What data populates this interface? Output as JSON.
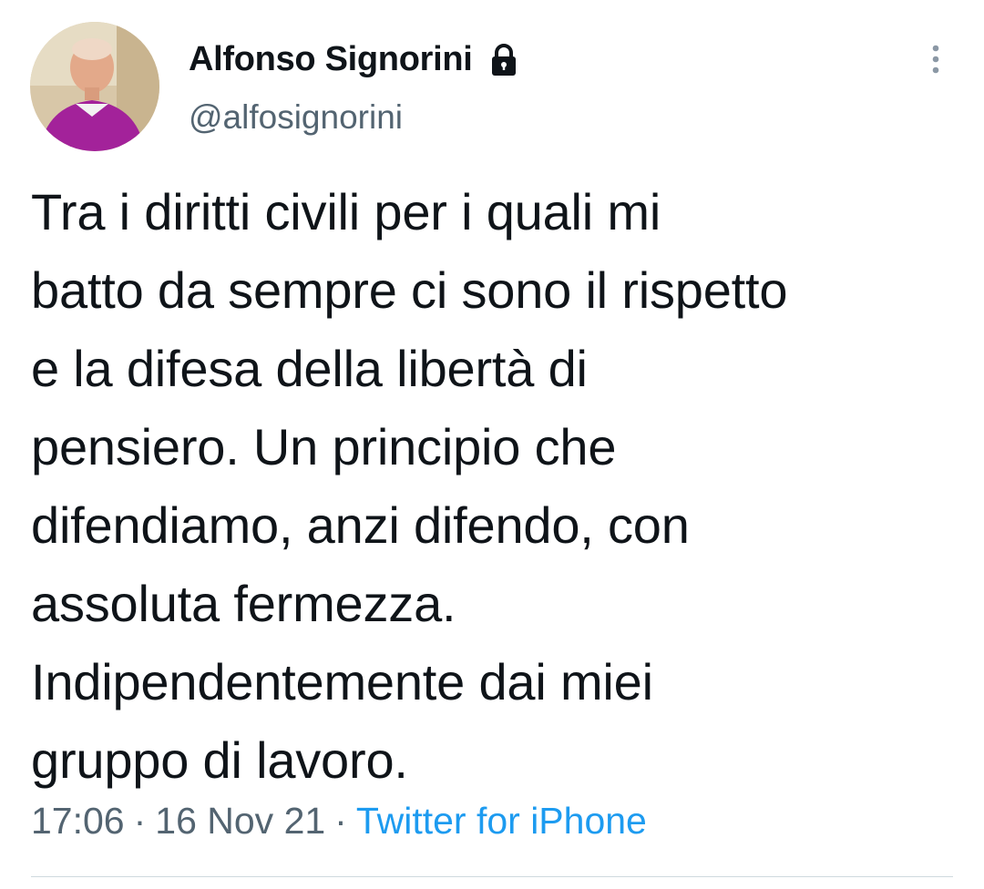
{
  "author": {
    "display_name": "Alfonso Signorini",
    "handle": "@alfosignorini",
    "avatar_icon": "profile-photo",
    "protected_icon": "lock-icon"
  },
  "tweet": {
    "text": "Tra i diritti civili per i quali mi\nbatto da sempre ci sono il rispetto\ne la difesa della libertà di\npensiero. Un principio che\ndifendiamo, anzi difendo, con\nassoluta fermezza.\nIndipendentemente dai miei\ngruppo di lavoro."
  },
  "meta": {
    "time": "17:06",
    "separator": "·",
    "date": "16 Nov 21",
    "source": "Twitter for iPhone"
  },
  "colors": {
    "text_primary": "#0f1419",
    "text_secondary": "#536471",
    "link": "#1d9bf0",
    "divider": "#cfd9de"
  },
  "menu": {
    "icon": "more-vertical-icon"
  }
}
